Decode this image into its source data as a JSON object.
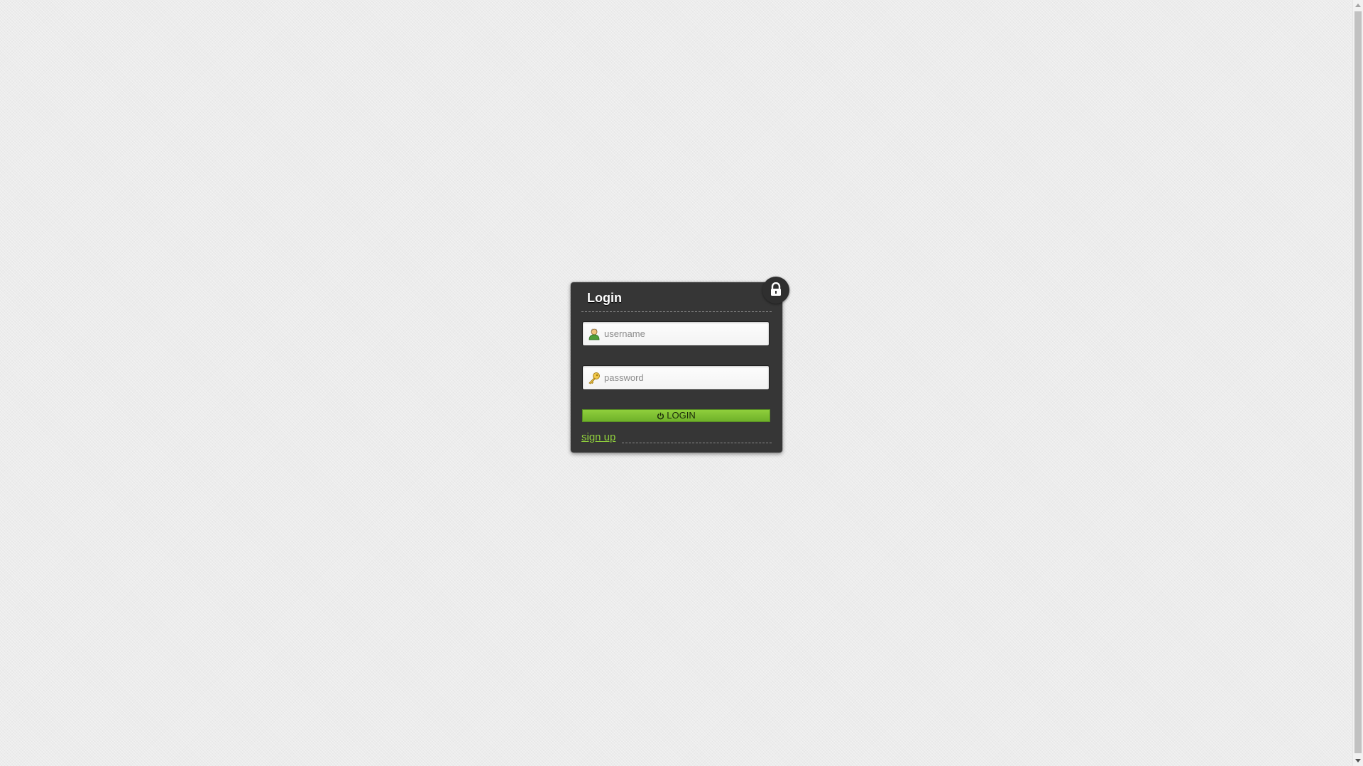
{
  "login": {
    "title": "Login",
    "username_placeholder": "username",
    "password_placeholder": "password",
    "login_button_label": "LOGIN",
    "signup_link_label": "sign up"
  },
  "icons": {
    "lock": "lock-icon",
    "user": "user-icon",
    "key": "key-icon",
    "power": "power-icon"
  },
  "colors": {
    "panel": "#363636",
    "accent": "#8fcf3c",
    "background": "#ececec"
  }
}
